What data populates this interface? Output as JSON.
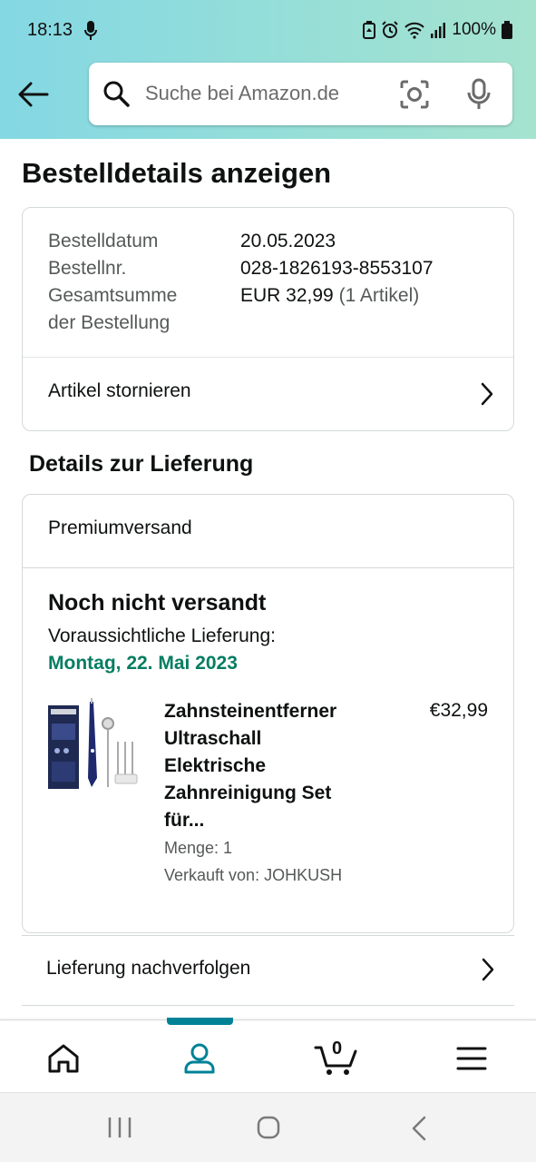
{
  "status_bar": {
    "time": "18:13",
    "battery": "100%"
  },
  "search": {
    "placeholder": "Suche bei Amazon.de"
  },
  "page": {
    "title": "Bestelldetails anzeigen"
  },
  "order_summary": {
    "date_label": "Bestelldatum",
    "date_value": "20.05.2023",
    "number_label": "Bestellnr.",
    "number_value": "028-1826193-8553107",
    "total_label_line1": "Gesamtsumme",
    "total_label_line2": "der Bestellung",
    "total_value": "EUR 32,99",
    "total_items": "(1 Artikel)",
    "cancel_label": "Artikel stornieren"
  },
  "delivery": {
    "section_title": "Details zur Lieferung",
    "shipping_method": "Premiumversand",
    "status": "Noch nicht versandt",
    "eta_label": "Voraussichtliche Lieferung:",
    "eta_date": "Montag, 22. Mai 2023",
    "eta_color": "#067D62"
  },
  "item": {
    "title": "Zahnsteinentferner Ultraschall Elektrische Zahnreinigung Set für...",
    "price": "€32,99",
    "quantity": "Menge: 1",
    "seller": "Verkauft von: JOHKUSH"
  },
  "track": {
    "label": "Lieferung nachverfolgen"
  },
  "bottom_nav": {
    "active_color": "#008296",
    "cart_count": "0",
    "items": [
      "home-icon",
      "account-icon",
      "cart-icon",
      "menu-icon"
    ]
  }
}
